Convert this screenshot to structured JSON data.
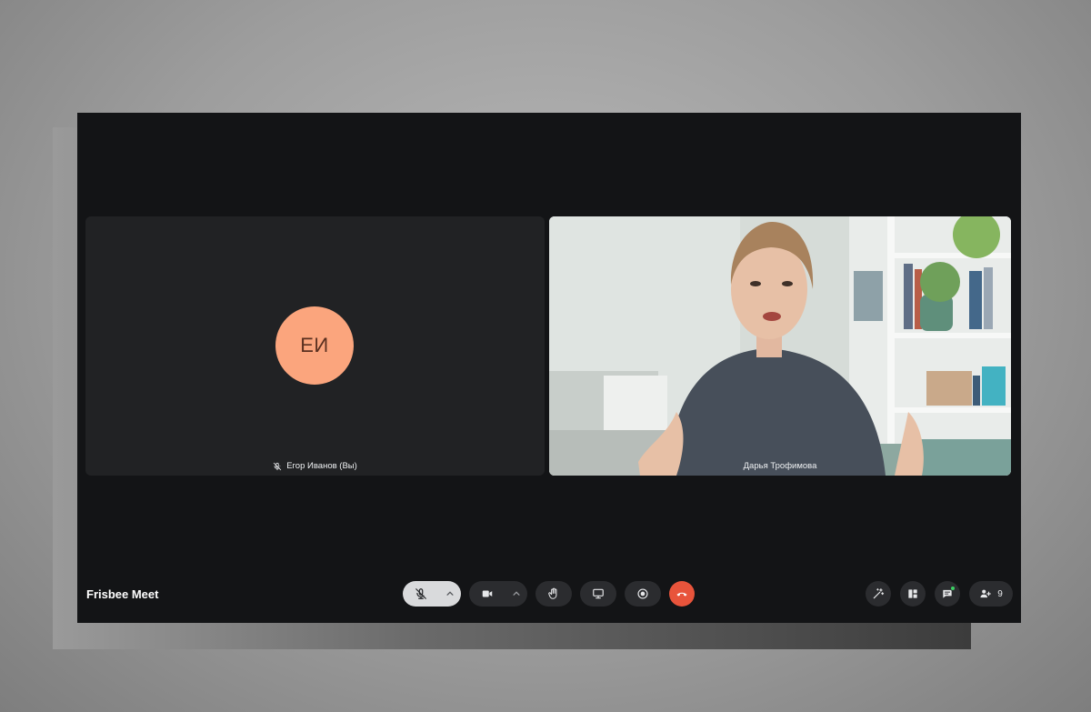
{
  "app": {
    "brand": "Frisbee Meet"
  },
  "participants": {
    "self": {
      "initials": "ЕИ",
      "name": "Егор Иванов (Вы)",
      "muted": true,
      "avatar_color": "#fba57d"
    },
    "remote": {
      "name": "Дарья Трофимова"
    }
  },
  "toolbar": {
    "participants_count": "9",
    "end_call_color": "#e8543b",
    "chat_unread_dot_color": "#3ccf63"
  },
  "icons": [
    "mic-off-icon",
    "chevron-up-icon",
    "video-camera-icon",
    "raise-hand-icon",
    "screen-share-icon",
    "record-icon",
    "hang-up-icon",
    "magic-wand-icon",
    "layout-icon",
    "chat-icon",
    "add-people-icon"
  ]
}
